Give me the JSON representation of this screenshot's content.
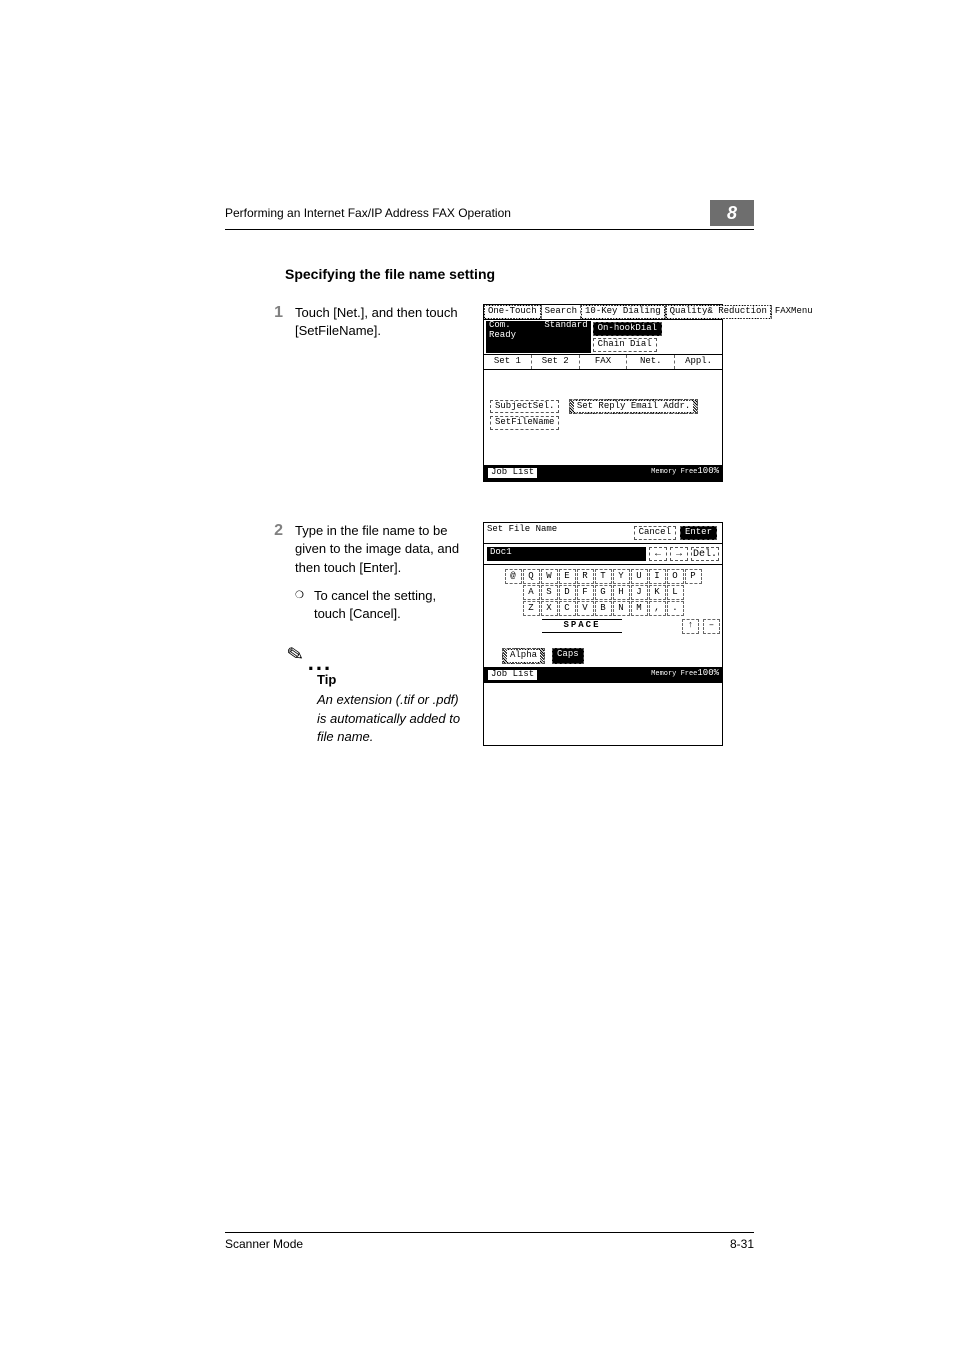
{
  "header": {
    "running_title": "Performing an Internet Fax/IP Address FAX Operation",
    "chapter_number": "8"
  },
  "section_title": "Specifying the file name setting",
  "steps": [
    {
      "num": "1",
      "text": "Touch [Net.], and then touch [SetFileName]."
    },
    {
      "num": "2",
      "text": "Type in the file name to be given to the image data, and then touch [Enter].",
      "sub": "To cancel the setting, touch [Cancel].",
      "tip_label": "Tip",
      "tip_text": "An extension (.tif or .pdf) is automatically added to file name."
    }
  ],
  "fig1": {
    "top_tabs": [
      "One-Touch",
      "Search",
      "10-Key Dialing",
      "Quality& Reduction",
      "FAXMenu"
    ],
    "status": {
      "left": "Com. Ready",
      "mid": "Standard",
      "btn1": "On-hookDial",
      "btn2": "Chain Dial"
    },
    "tabs2": [
      "Set 1",
      "Set 2",
      "FAX",
      "Net.",
      "Appl."
    ],
    "body_btns": [
      "SubjectSel.",
      "Set Reply Email Addr.",
      "SetFileName"
    ],
    "footer_left": "Job List",
    "footer_right_label": "Memory Free",
    "footer_right_value": "100%"
  },
  "fig2": {
    "title": "Set File Name",
    "cancel": "Cancel",
    "enter": "Enter",
    "input_value": "Doc1",
    "del": "Del.",
    "row1": [
      "@",
      "Q",
      "W",
      "E",
      "R",
      "T",
      "Y",
      "U",
      "I",
      "O",
      "P"
    ],
    "row2": [
      "A",
      "S",
      "D",
      "F",
      "G",
      "H",
      "J",
      "K",
      "L"
    ],
    "row3": [
      "Z",
      "X",
      "C",
      "V",
      "B",
      "N",
      "M",
      ",",
      "."
    ],
    "space": "SPACE",
    "shiftkeys": [
      "↑",
      "–"
    ],
    "mode_alpha": "Alpha",
    "mode_caps": "Caps",
    "footer_left": "Job List",
    "footer_right_label": "Memory Free",
    "footer_right_value": "100%"
  },
  "footer": {
    "left": "Scanner Mode",
    "right": "8-31"
  }
}
